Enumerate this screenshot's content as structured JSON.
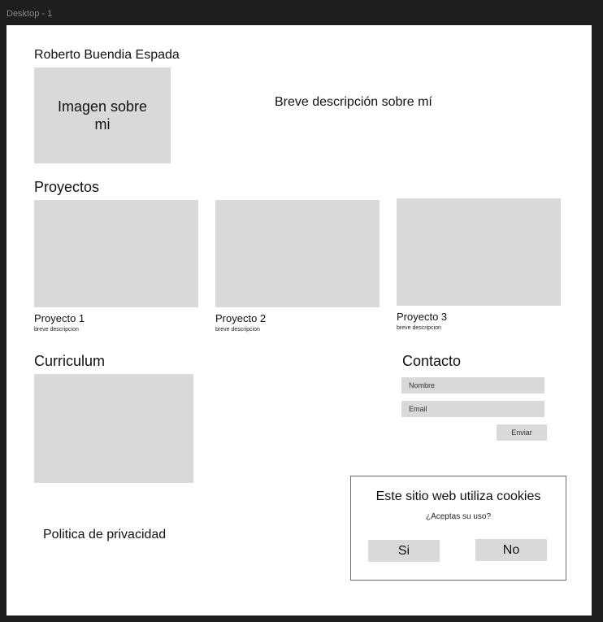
{
  "window": {
    "frame_label": "Desktop - 1"
  },
  "header": {
    "name": "Roberto Buendia Espada",
    "image_placeholder": "Imagen sobre mi",
    "description": "Breve descripción sobre mí"
  },
  "projects": {
    "title": "Proyectos",
    "items": [
      {
        "name": "Proyecto 1",
        "description": "breve descripcion"
      },
      {
        "name": "Proyecto 2",
        "description": "breve descripcion"
      },
      {
        "name": "Proyecto 3",
        "description": "breve descripcion"
      }
    ]
  },
  "curriculum": {
    "title": "Curriculum"
  },
  "contact": {
    "title": "Contacto",
    "name_placeholder": "Nombre",
    "email_placeholder": "Email",
    "send_label": "Enviar"
  },
  "footer": {
    "privacy_link": "Politica de privacidad"
  },
  "cookie_banner": {
    "title": "Este sitio web utiliza cookies",
    "question": "¿Aceptas su uso?",
    "accept_label": "Si",
    "reject_label": "No"
  },
  "colors": {
    "background": "#1e1e1e",
    "frame": "#ffffff",
    "placeholder": "#d9d9d9"
  }
}
